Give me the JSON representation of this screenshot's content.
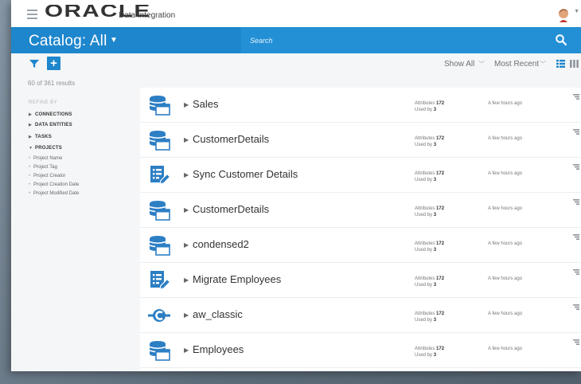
{
  "app": {
    "brand": "ORACLE",
    "product": "Data Integration"
  },
  "header": {
    "catalog_title": "Catalog: All",
    "search_placeholder": "Search"
  },
  "toolbar": {
    "show_all": "Show All",
    "most_recent": "Most Recent"
  },
  "sidebar": {
    "results_count": "60 of 361 results",
    "refine_by": "REFINE BY",
    "facets": [
      {
        "label": "CONNECTIONS",
        "expanded": false
      },
      {
        "label": "DATA ENTITIES",
        "expanded": false
      },
      {
        "label": "TASKS",
        "expanded": false
      },
      {
        "label": "PROJECTS",
        "expanded": true
      }
    ],
    "project_filters": [
      "Project Name",
      "Project Tag",
      "Project Creator",
      "Project Creation Date",
      "Project Modified Date"
    ]
  },
  "list": {
    "rows": [
      {
        "name": "Sales",
        "icon": "database-table-icon",
        "attributes_label": "Attributes",
        "attributes": "172",
        "used_by_label": "Used by",
        "used_by": "3",
        "time": "A few hours ago"
      },
      {
        "name": "CustomerDetails",
        "icon": "database-table-icon",
        "attributes_label": "Attributes",
        "attributes": "172",
        "used_by_label": "Used by",
        "used_by": "3",
        "time": "A few hours ago"
      },
      {
        "name": "Sync Customer Details",
        "icon": "task-edit-icon",
        "attributes_label": "Attributes",
        "attributes": "172",
        "used_by_label": "Used by",
        "used_by": "3",
        "time": "A few hours ago"
      },
      {
        "name": "CustomerDetails",
        "icon": "database-table-icon",
        "attributes_label": "Attributes",
        "attributes": "172",
        "used_by_label": "Used by",
        "used_by": "3",
        "time": "A few hours ago"
      },
      {
        "name": "condensed2",
        "icon": "database-table-icon",
        "attributes_label": "Attributes",
        "attributes": "172",
        "used_by_label": "Used by",
        "used_by": "3",
        "time": "A few hours ago"
      },
      {
        "name": "Migrate Employees",
        "icon": "task-edit-icon",
        "attributes_label": "Attributes",
        "attributes": "172",
        "used_by_label": "Used by",
        "used_by": "3",
        "time": "A few hours ago"
      },
      {
        "name": "aw_classic",
        "icon": "connection-icon",
        "attributes_label": "Attributes",
        "attributes": "172",
        "used_by_label": "Used by",
        "used_by": "3",
        "time": "A few hours ago"
      },
      {
        "name": "Employees",
        "icon": "database-table-icon",
        "attributes_label": "Attributes",
        "attributes": "172",
        "used_by_label": "Used by",
        "used_by": "3",
        "time": "A few hours ago"
      }
    ]
  },
  "colors": {
    "brand_blue": "#1e86cc",
    "icon_blue": "#2d7fc4"
  }
}
